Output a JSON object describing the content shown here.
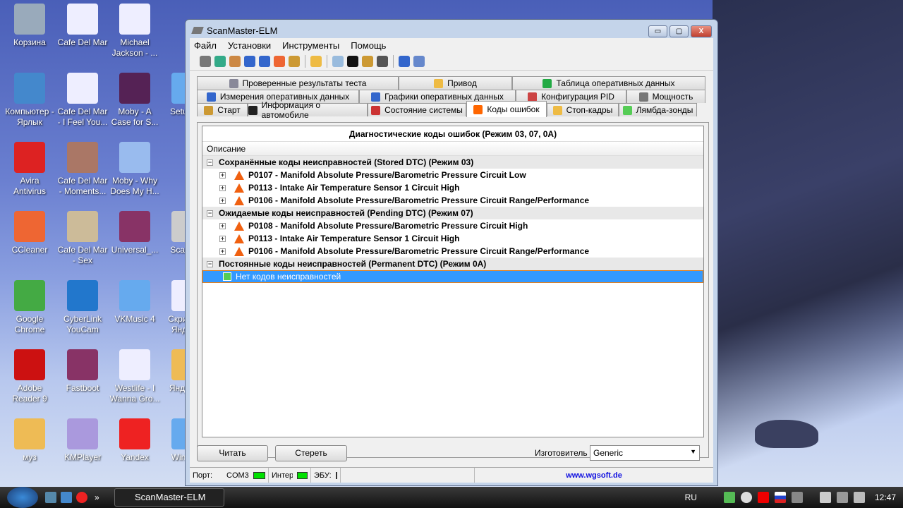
{
  "desktop": {
    "icons": [
      {
        "label": "Корзина",
        "color": "#9ab"
      },
      {
        "label": "Компьютер - Ярлык",
        "color": "#48c"
      },
      {
        "label": "Avira Antivirus",
        "color": "#d22"
      },
      {
        "label": "CCleaner",
        "color": "#e63"
      },
      {
        "label": "Google Chrome",
        "color": "#4a4"
      },
      {
        "label": "Adobe Reader 9",
        "color": "#c11"
      },
      {
        "label": "муз",
        "color": "#eb5"
      },
      {
        "label": "Cafe Del Mar",
        "color": "#eef"
      },
      {
        "label": "Cafe Del Mar - I Feel You...",
        "color": "#eef"
      },
      {
        "label": "Cafe Del Mar - Moments...",
        "color": "#a76"
      },
      {
        "label": "Cafe Del Mar - Sex",
        "color": "#cb9"
      },
      {
        "label": "CyberLink YouCam",
        "color": "#27c"
      },
      {
        "label": "Fastboot",
        "color": "#836"
      },
      {
        "label": "KMPlayer",
        "color": "#a9d"
      },
      {
        "label": "Michael Jackson - ...",
        "color": "#eef"
      },
      {
        "label": "Moby - A Case for S...",
        "color": "#525"
      },
      {
        "label": "Moby - Why Does My H...",
        "color": "#9be"
      },
      {
        "label": "Universal_...",
        "color": "#836"
      },
      {
        "label": "VKMusic 4",
        "color": "#6ae"
      },
      {
        "label": "Westlife - I Wanna Gro...",
        "color": "#eef"
      },
      {
        "label": "Yandex",
        "color": "#e22"
      },
      {
        "label": "Setup_...",
        "color": "#6ae"
      },
      {
        "label": "ScanM...",
        "color": "#ccc"
      },
      {
        "label": "Скрин... в Яндек...",
        "color": "#eef"
      },
      {
        "label": "Яндекс...",
        "color": "#eb5"
      },
      {
        "label": "WinTh...",
        "color": "#6ae"
      }
    ]
  },
  "window": {
    "title": "ScanMaster-ELM",
    "minimize": "▭",
    "maximize": "▢",
    "close": "X"
  },
  "menu": [
    "Файл",
    "Установки",
    "Инструменты",
    "Помощь"
  ],
  "toolbar": [
    "connect",
    "globe",
    "pid-config",
    "table",
    "chart",
    "windows",
    "person",
    "clipboard",
    "search",
    "terminal",
    "device",
    "gauge",
    "info",
    "exit"
  ],
  "tabs": {
    "row1": [
      "Проверенные результаты теста",
      "Привод",
      "Таблица оперативных данных"
    ],
    "row2": [
      "Измерения оперативных данных",
      "Графики оперативных данных",
      "Конфигурация PID",
      "Мощность"
    ],
    "row3": [
      "Старт",
      "Информация о автомобиле",
      "Состояние системы",
      "Коды ошибок",
      "Стоп-кадры",
      "Лямбда-зонды"
    ],
    "active": "Коды ошибок"
  },
  "dtc": {
    "header": "Диагностические коды ошибок (Режим 03, 07, 0A)",
    "column": "Описание",
    "groups": [
      {
        "title": "Сохранённые коды неисправностей (Stored DTC) (Режим 03)",
        "codes": [
          "P0107 - Manifold Absolute Pressure/Barometric Pressure Circuit Low",
          "P0113 - Intake Air Temperature Sensor 1 Circuit High",
          "P0106 - Manifold Absolute Pressure/Barometric Pressure Circuit Range/Performance"
        ]
      },
      {
        "title": "Ожидаемые коды неисправностей (Pending DTC) (Режим 07)",
        "codes": [
          "P0108 - Manifold Absolute Pressure/Barometric Pressure Circuit High",
          "P0113 - Intake Air Temperature Sensor 1 Circuit High",
          "P0106 - Manifold Absolute Pressure/Barometric Pressure Circuit Range/Performance"
        ]
      },
      {
        "title": "Постоянные коды неисправностей (Permanent DTC) (Режим 0A)",
        "empty": "Нет кодов неисправностей"
      }
    ]
  },
  "buttons": {
    "read": "Читать",
    "clear": "Стереть"
  },
  "manufacturer": {
    "label": "Изготовитель",
    "value": "Generic"
  },
  "status": {
    "port_label": "Порт:",
    "port": "COM3",
    "interface_label": "Интерфейс:",
    "ecu_label": "ЭБУ:",
    "url": "www.wgsoft.de",
    "led_color": "#00e000"
  },
  "taskbar": {
    "task": "ScanMaster-ELM",
    "lang": "RU",
    "clock": "12:47"
  }
}
